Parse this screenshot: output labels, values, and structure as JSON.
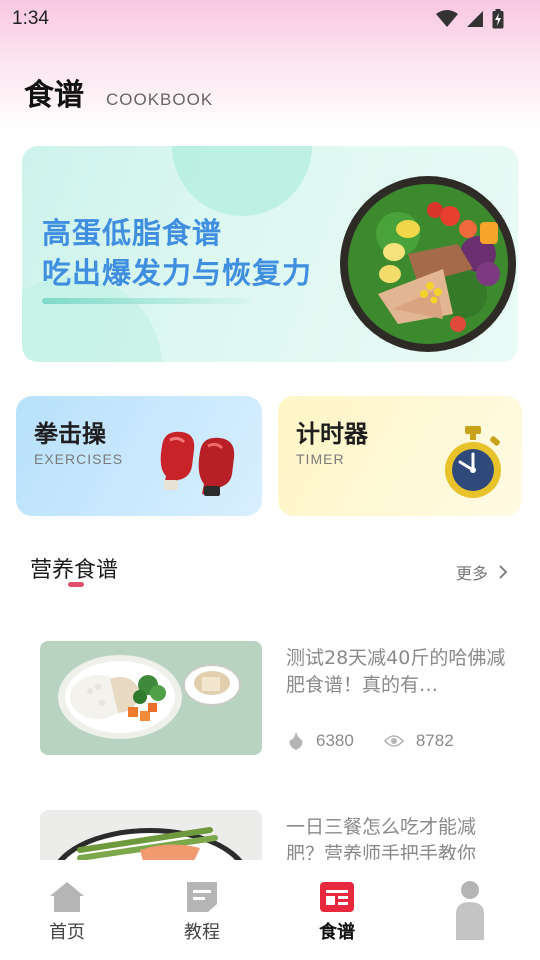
{
  "status_bar": {
    "time": "1:34"
  },
  "header": {
    "title": "食谱",
    "subtitle": "COOKBOOK"
  },
  "banner": {
    "line1": "高蛋低脂食谱",
    "line2": "吃出爆发力与恢复力"
  },
  "cards": [
    {
      "title": "拳击操",
      "subtitle": "EXERCISES",
      "icon": "boxing-gloves-icon"
    },
    {
      "title": "计时器",
      "subtitle": "TIMER",
      "icon": "stopwatch-icon"
    }
  ],
  "section": {
    "title": "营养食谱",
    "more": "更多"
  },
  "recipes": [
    {
      "title": "测试28天减40斤的哈佛减肥食谱！真的有…",
      "likes": "6380",
      "views": "8782"
    },
    {
      "title": "一日三餐怎么吃才能减肥？营养师手把手教你"
    }
  ],
  "tabs": [
    {
      "label": "首页",
      "icon": "home-icon"
    },
    {
      "label": "教程",
      "icon": "document-icon"
    },
    {
      "label": "食谱",
      "icon": "recipe-icon"
    },
    {
      "label": "",
      "icon": "profile-icon"
    }
  ],
  "colors": {
    "accent": "#e0506e",
    "banner_text": "#3f8ee0",
    "active_tab": "#e8283c"
  }
}
